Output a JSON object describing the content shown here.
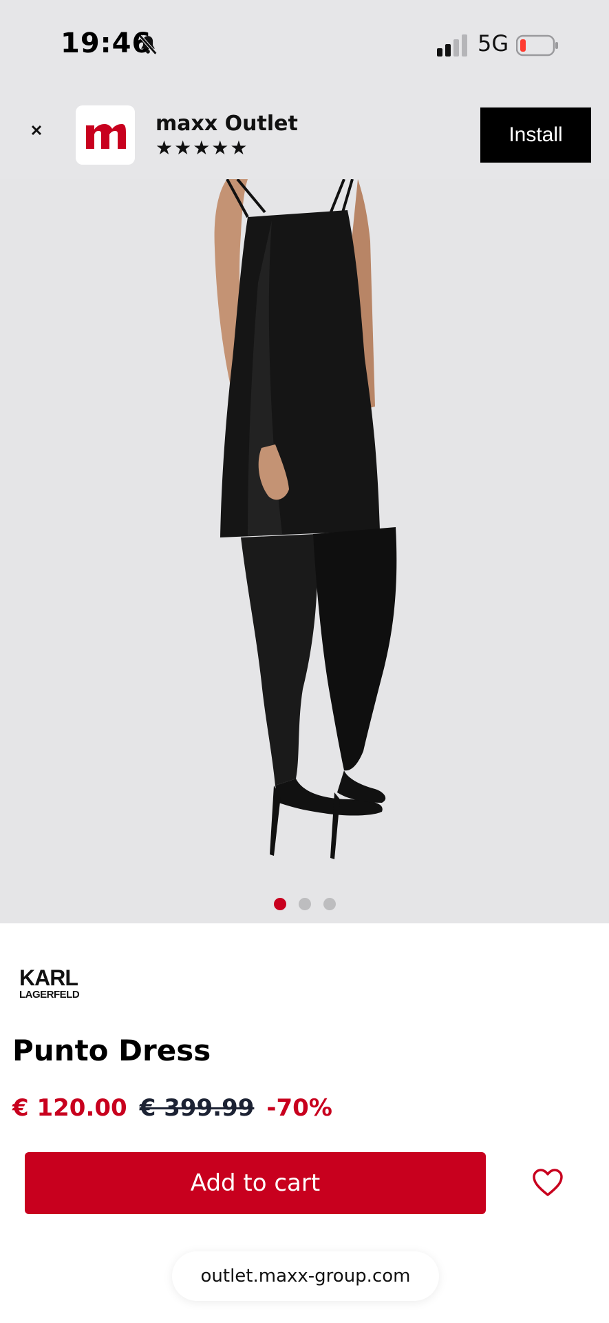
{
  "status_bar": {
    "time": "19:46",
    "network": "5G",
    "icons": [
      "bell-slash-icon",
      "signal-icon",
      "battery-low-icon"
    ]
  },
  "app_banner": {
    "app_name": "maxx Outlet",
    "rating_stars": "★★★★★",
    "install_label": "Install",
    "icon_letter": "m"
  },
  "carousel": {
    "dot_count": 3,
    "active_index": 0
  },
  "product": {
    "brand_top": "KARL",
    "brand_bottom": "LAGERFELD",
    "name": "Punto Dress",
    "price_current": "€ 120.00",
    "price_original": "€ 399.99",
    "discount": "-70%"
  },
  "actions": {
    "add_to_cart_label": "Add to cart"
  },
  "browser": {
    "url": "outlet.maxx-group.com"
  },
  "colors": {
    "accent_red": "#c8001e",
    "banner_bg": "#e6e6e8",
    "image_bg": "#e5e5e7"
  }
}
